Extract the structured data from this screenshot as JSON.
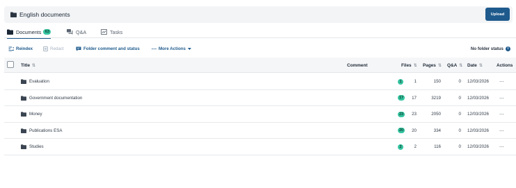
{
  "header": {
    "title": "English documents",
    "upload_label": "Upload"
  },
  "tabs": [
    {
      "label": "Documents",
      "badge": "63",
      "icon": "folder-icon"
    },
    {
      "label": "Q&A",
      "icon": "chat-icon"
    },
    {
      "label": "Tasks",
      "icon": "tasks-icon"
    }
  ],
  "toolbar": {
    "reindex": "Reindex",
    "redact": "Redact",
    "folder_comment": "Folder comment and status",
    "more_actions": "More Actions",
    "folder_status": "No folder status"
  },
  "columns": {
    "title": "Title",
    "comment": "Comment",
    "files": "Files",
    "pages": "Pages",
    "qa": "Q&A",
    "date": "Date",
    "actions": "Actions"
  },
  "rows": [
    {
      "name": "Evaluation",
      "badge": "1",
      "files": "1",
      "pages": "150",
      "qa": "0",
      "date": "12/03/2026"
    },
    {
      "name": "Government documentation",
      "badge": "17",
      "files": "17",
      "pages": "3219",
      "qa": "0",
      "date": "12/03/2026"
    },
    {
      "name": "Money",
      "badge": "23",
      "files": "23",
      "pages": "2050",
      "qa": "0",
      "date": "12/03/2026"
    },
    {
      "name": "Publications ESA",
      "badge": "20",
      "files": "20",
      "pages": "334",
      "qa": "0",
      "date": "12/03/2026"
    },
    {
      "name": "Studies",
      "badge": "2",
      "files": "2",
      "pages": "116",
      "qa": "0",
      "date": "12/03/2026"
    }
  ],
  "colors": {
    "accent": "#1e5a8c",
    "badge": "#36c5a1"
  }
}
